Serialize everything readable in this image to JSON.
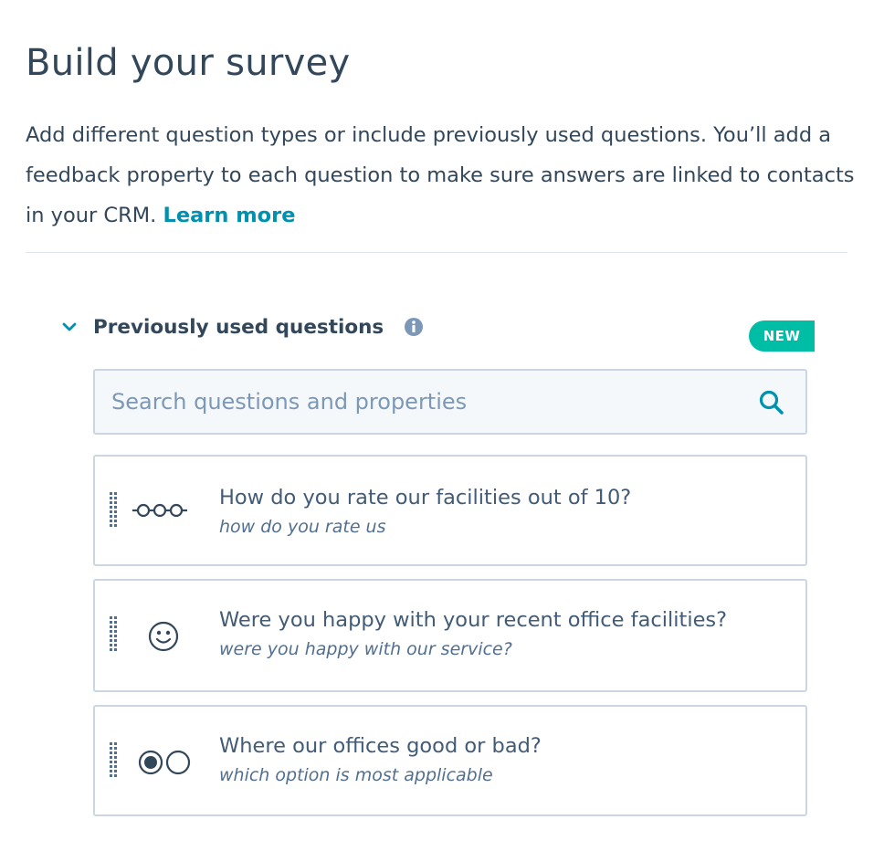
{
  "header": {
    "title": "Build your survey",
    "description": "Add different question types or include previously used questions. You’ll add a feedback property to each question to make sure answers are linked to contacts in your CRM.",
    "learn_more": "Learn more"
  },
  "section": {
    "title": "Previously used questions",
    "badge": "NEW",
    "collapse_icon": "chevron-down-icon",
    "info_icon": "info-icon"
  },
  "search": {
    "placeholder": "Search questions and properties",
    "value": "",
    "icon": "search-icon"
  },
  "questions": [
    {
      "label": "How do you rate our facilities out of 10?",
      "property": "how do you rate us",
      "icon": "rating-scale-icon"
    },
    {
      "label": "Were you happy with your recent office facilities?",
      "property": "were you happy with our service?",
      "icon": "smiley-face-icon"
    },
    {
      "label": "Where our offices good or bad?",
      "property": "which option is most applicable",
      "icon": "radio-options-icon"
    }
  ],
  "colors": {
    "text": "#33475b",
    "link": "#0091ae",
    "badge": "#00bda5",
    "border": "#cbd6e2",
    "placeholder": "#7c98b6"
  }
}
